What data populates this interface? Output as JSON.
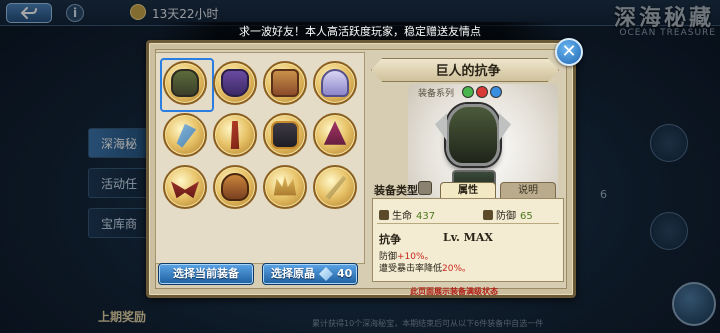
{
  "top_bar": {
    "timer_text": "13天22小时",
    "info_glyph": "i",
    "event_title": "深海秘藏",
    "event_subtitle": "OCEAN TREASURE"
  },
  "notice": "求一波好友！本人高活跃度玩家，稳定赠送友情点",
  "side_menu": [
    {
      "label": "深海秘",
      "active": true
    },
    {
      "label": "活动任",
      "active": false
    },
    {
      "label": "宝库商",
      "active": false
    }
  ],
  "prev_reward": "上期奖励",
  "right_count": "6",
  "bottom_note": "累计获得10个深海秘宝，本期结束后可从以下6件装备中自选一件",
  "modal": {
    "close_glyph": "✕",
    "equipment": [
      {
        "icon": "horned-helmet-icon",
        "art": "helmet",
        "selected": true
      },
      {
        "icon": "purple-cloak-icon",
        "art": "cloak",
        "selected": false
      },
      {
        "icon": "bronze-armor-icon",
        "art": "armor",
        "selected": false
      },
      {
        "icon": "winged-hat-icon",
        "art": "hat",
        "selected": false
      },
      {
        "icon": "crystal-axe-icon",
        "art": "axe",
        "selected": false
      },
      {
        "icon": "flame-staff-icon",
        "art": "staff",
        "selected": false
      },
      {
        "icon": "dark-suit-icon",
        "art": "suit",
        "selected": false
      },
      {
        "icon": "witch-hat-icon",
        "art": "witch",
        "selected": false
      },
      {
        "icon": "demon-wings-icon",
        "art": "wings",
        "selected": false
      },
      {
        "icon": "orange-mask-icon",
        "art": "mask",
        "selected": false
      },
      {
        "icon": "golden-crown-icon",
        "art": "crown",
        "selected": false
      },
      {
        "icon": "golden-blade-icon",
        "art": "blade",
        "selected": false
      }
    ],
    "btn_select_current": "选择当前装备",
    "btn_select_material": "选择原晶",
    "material_count": "40",
    "detail": {
      "name": "巨人的抗争",
      "series_label": "装备系列",
      "equip_type_label": "装备类型",
      "tabs": {
        "attr": "属性",
        "desc": "说明"
      },
      "stats": {
        "hp_label": "生命",
        "hp_value": "437",
        "def_label": "防御",
        "def_value": "65"
      },
      "skill": {
        "name": "抗争",
        "level": "Lv. MAX",
        "line1_prefix": "防御",
        "line1_value": "+10%。",
        "line2_prefix": "遭受暴击率降低",
        "line2_value": "20%。"
      },
      "max_note": "此页面展示装备满级状态"
    }
  },
  "colors": {
    "panel_bg": "#d7cdb2",
    "accent_blue": "#1f66b3",
    "stat_value_green": "#4d7b1f",
    "highlight_red": "#c8281c"
  }
}
